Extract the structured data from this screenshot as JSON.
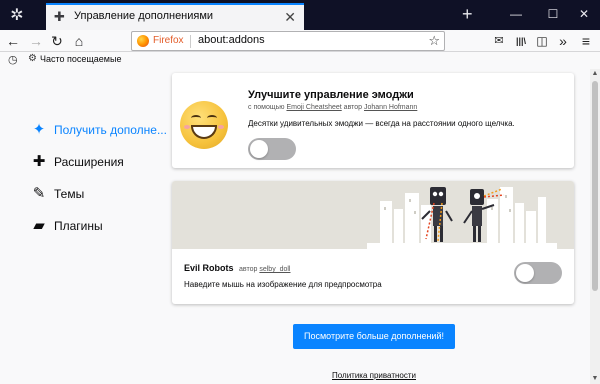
{
  "window": {
    "tab_title": "Управление дополнениями",
    "tab_close": "✕",
    "new_tab": "+",
    "menu_icon": "✲",
    "controls": {
      "minimize": "—",
      "maximize": "☐",
      "close": "✕"
    }
  },
  "navbar": {
    "back": "←",
    "forward": "→",
    "reload": "↻",
    "home": "⌂",
    "identity": "Firefox",
    "url": "about:addons",
    "bookmark_star": "☆",
    "right_icons": {
      "inbox": "✉",
      "library": "|||\\",
      "sidebar": "◫",
      "overflow": "»",
      "menu": "≡"
    }
  },
  "bookmarks": {
    "toolbar_icon": "◷",
    "items": [
      {
        "icon": "⚙",
        "label": "Часто посещаемые"
      }
    ]
  },
  "sidebar": {
    "items": [
      {
        "label": "Получить дополне...",
        "icon": "puzzle-sparkle-icon",
        "glyph": "✦",
        "active": true
      },
      {
        "label": "Расширения",
        "icon": "puzzle-icon",
        "glyph": "✚",
        "active": false
      },
      {
        "label": "Темы",
        "icon": "brush-icon",
        "glyph": "✎",
        "active": false
      },
      {
        "label": "Плагины",
        "icon": "plugin-icon",
        "glyph": "▰",
        "active": false
      }
    ]
  },
  "cards": [
    {
      "title": "Улучшите управление эмоджи",
      "by_prefix": "с помощью",
      "addon_link": "Emoji Cheatsheet",
      "author_prefix": "автор",
      "author": "Johann Hofmann",
      "description": "Десятки удивительных эмоджи — всегда на расстоянии одного щелчка.",
      "installed": false
    },
    {
      "title": "Evil Robots",
      "author_prefix": "автор",
      "author": "selby_doll",
      "description": "Наведите мышь на изображение для предпросмотра",
      "installed": false
    }
  ],
  "more_button": "Посмотрите больше дополнений!",
  "privacy_link": "Политика приватности",
  "colors": {
    "accent": "#0a84ff",
    "titlebar": "#0f1126",
    "toggle_off": "#b1b1b3",
    "banner": "#e3e1da"
  }
}
